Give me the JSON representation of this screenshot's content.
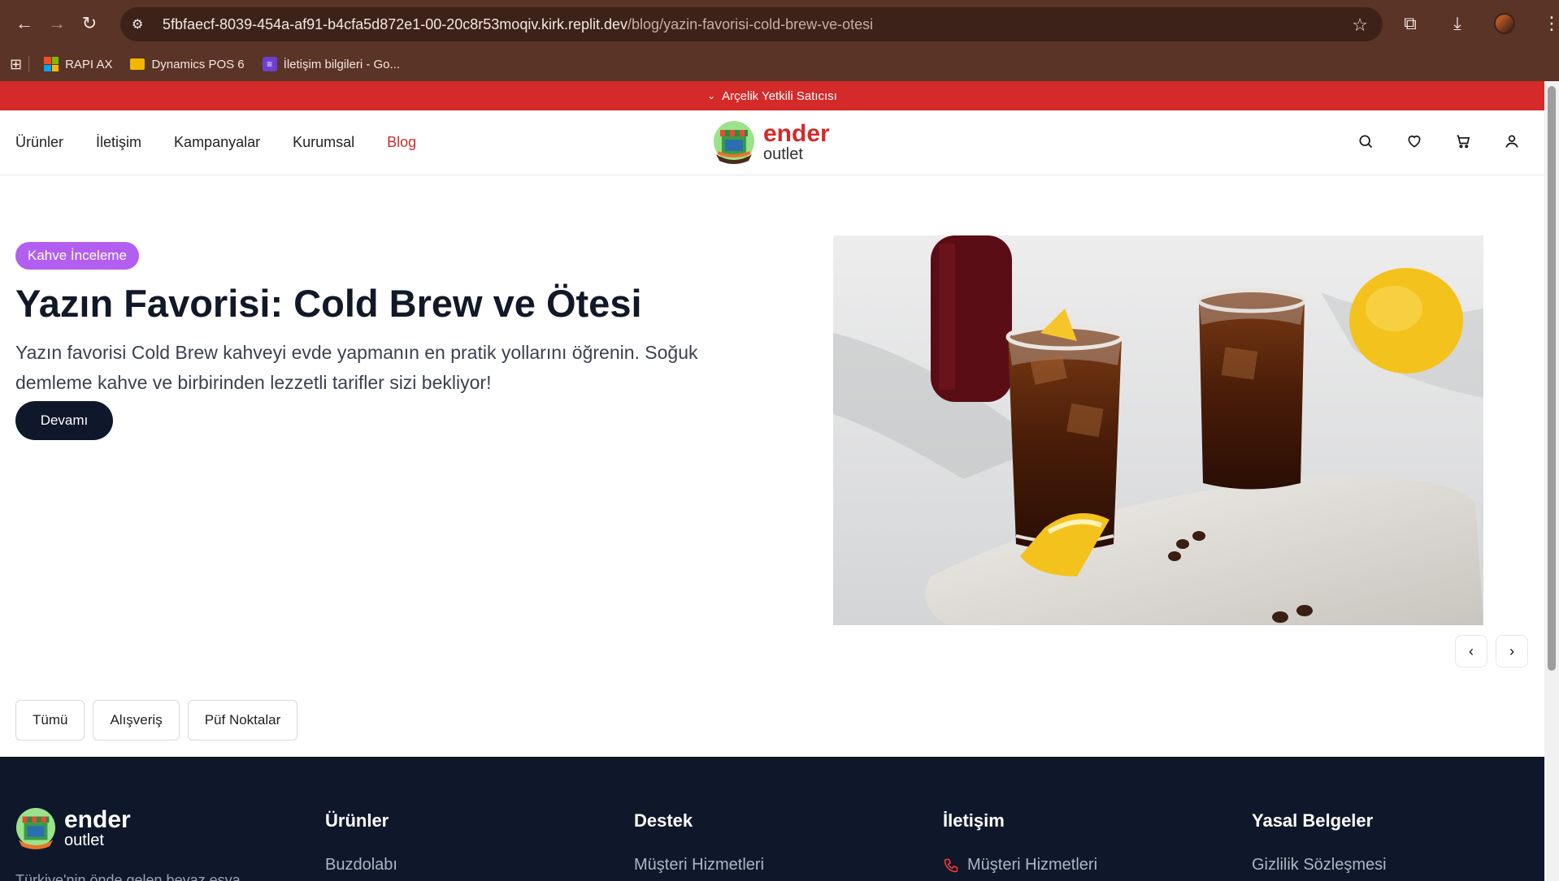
{
  "browser": {
    "url_host": "5fbfaecf-8039-454a-af91-b4cfa5d872e1-00-20c8r53moqiv.kirk.replit.dev",
    "url_path": "/blog/yazin-favorisi-cold-brew-ve-otesi",
    "bookmarks": [
      {
        "label": "RAPI AX",
        "icon": "microsoft-icon"
      },
      {
        "label": "Dynamics POS 6",
        "icon": "folder-icon"
      },
      {
        "label": "İletişim bilgileri - Go...",
        "icon": "forms-icon"
      }
    ]
  },
  "promo": {
    "text": "Arçelik Yetkili Satıcısı"
  },
  "nav": {
    "items": [
      {
        "label": "Ürünler"
      },
      {
        "label": "İletişim"
      },
      {
        "label": "Kampanyalar"
      },
      {
        "label": "Kurumsal"
      },
      {
        "label": "Blog",
        "active": true
      }
    ]
  },
  "brand": {
    "name": "ender",
    "sub": "outlet",
    "accent": "#d42a2a"
  },
  "hero": {
    "badge": "Kahve İnceleme",
    "title": "Yazın Favorisi: Cold Brew ve Ötesi",
    "description": "Yazın favorisi Cold Brew kahveyi evde yapmanın en pratik yollarını öğrenin. Soğuk demleme kahve ve birbirinden lezzetli tarifler sizi bekliyor!",
    "cta": "Devamı"
  },
  "filters": [
    {
      "label": "Tümü"
    },
    {
      "label": "Alışveriş"
    },
    {
      "label": "Püf Noktalar"
    }
  ],
  "footer": {
    "brand_name": "ender",
    "brand_sub": "outlet",
    "tagline": "Türkiye'nin önde gelen beyaz eşya",
    "columns": [
      {
        "title": "Ürünler",
        "first_link": "Buzdolabı"
      },
      {
        "title": "Destek",
        "first_link": "Müşteri Hizmetleri"
      },
      {
        "title": "İletişim",
        "first_link": "Müşteri Hizmetleri"
      },
      {
        "title": "Yasal Belgeler",
        "first_link": "Gizlilik Sözleşmesi"
      }
    ]
  }
}
